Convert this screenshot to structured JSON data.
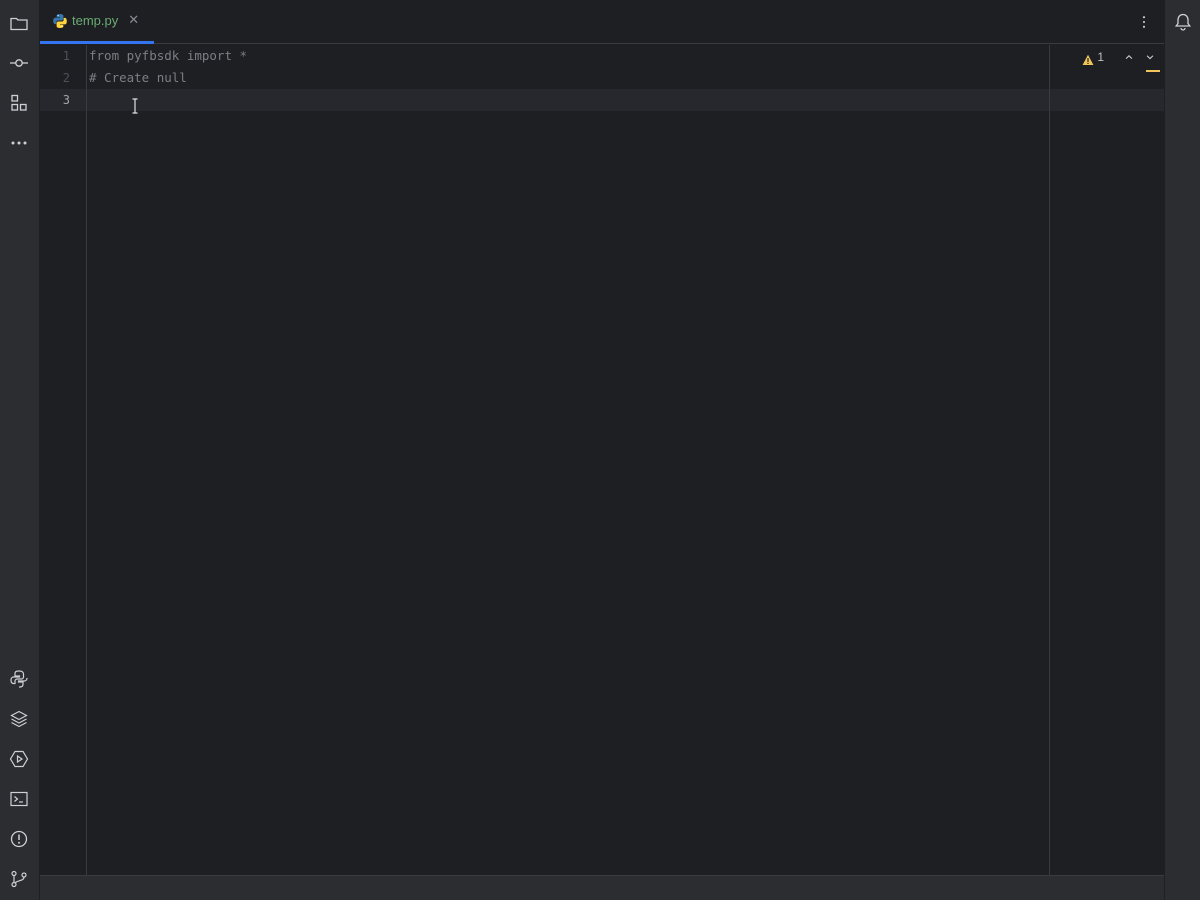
{
  "colors": {
    "accent": "#3574f0",
    "tab_text_python": "#6aab73",
    "warning": "#f2c55c",
    "background": "#1e1f22",
    "panel": "#2b2d30"
  },
  "left_toolbar": {
    "top_items": [
      {
        "name": "project-folder-icon"
      },
      {
        "name": "commit-icon"
      },
      {
        "name": "structure-icon"
      },
      {
        "name": "more-tools-icon"
      }
    ],
    "bottom_items": [
      {
        "name": "python-console-icon"
      },
      {
        "name": "layers-icon"
      },
      {
        "name": "services-icon"
      },
      {
        "name": "terminal-icon"
      },
      {
        "name": "problems-icon"
      },
      {
        "name": "git-icon"
      }
    ]
  },
  "right_toolbar": {
    "notifications_icon": "bell-icon"
  },
  "tabs": [
    {
      "label": "temp.py",
      "icon": "python-icon",
      "active": true
    }
  ],
  "editor": {
    "lines": [
      {
        "number": "1",
        "text": "from pyfbsdk import *"
      },
      {
        "number": "2",
        "text": "# Create null"
      },
      {
        "number": "3",
        "text": ""
      }
    ],
    "current_line": 3,
    "inspections": {
      "warning_count": "1"
    }
  }
}
